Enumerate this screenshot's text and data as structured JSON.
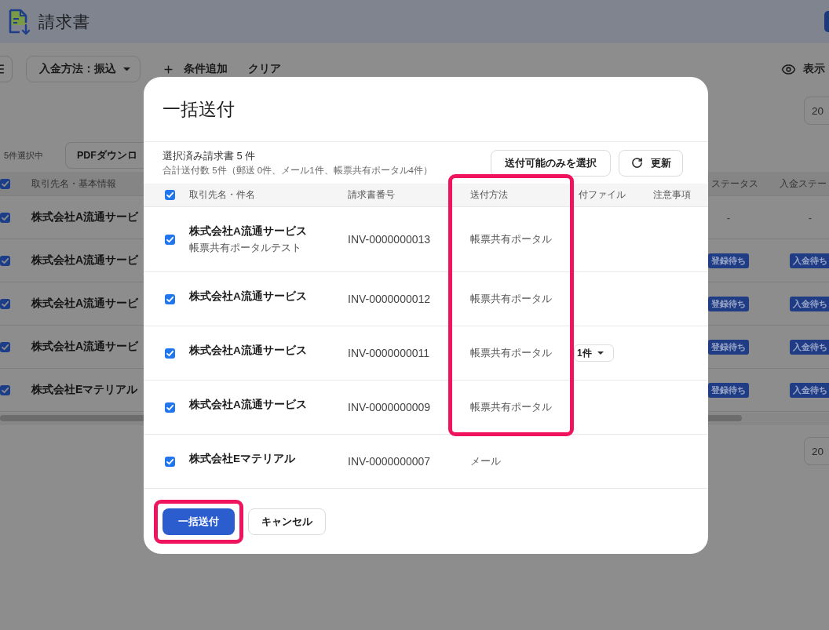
{
  "header": {
    "title": "請求書"
  },
  "filter_bar": {
    "filters": [
      {
        "label": "入金方法：振込"
      }
    ],
    "add_condition": "条件追加",
    "clear": "クリア",
    "display_settings": "表示"
  },
  "top_page_size": "20",
  "selection": {
    "count": "5件選択中",
    "pdf_download": "PDFダウンロ"
  },
  "table": {
    "all_checked": true,
    "columns": [
      "取引先名・基本情報",
      "ステータス",
      "入金ステー"
    ],
    "rows": [
      {
        "checked": true,
        "name": "株式会社A流通サービ",
        "status": {
          "kind": "dash",
          "text": "-"
        },
        "payment_status": {
          "kind": "dash",
          "text": "-"
        }
      },
      {
        "checked": true,
        "name": "株式会社A流通サービ",
        "status": {
          "kind": "badge",
          "text": "登録待ち"
        },
        "payment_status": {
          "kind": "badge",
          "text": "入金待ち"
        }
      },
      {
        "checked": true,
        "name": "株式会社A流通サービ",
        "status": {
          "kind": "badge",
          "text": "登録待ち"
        },
        "payment_status": {
          "kind": "badge",
          "text": "入金待ち"
        }
      },
      {
        "checked": true,
        "name": "株式会社A流通サービ",
        "status": {
          "kind": "badge",
          "text": "登録待ち"
        },
        "payment_status": {
          "kind": "badge",
          "text": "入金待ち"
        }
      },
      {
        "checked": true,
        "name": "株式会社Eマテリアル",
        "status": {
          "kind": "badge",
          "text": "登録待ち"
        },
        "payment_status": {
          "kind": "badge",
          "text": "入金待ち"
        }
      }
    ]
  },
  "bottom_page_size": "20",
  "dialog": {
    "title": "一括送付",
    "summary": "選択済み請求書 5 件",
    "summary_detail": "合計送付数 5件（郵送 0件、メール1件、帳票共有ポータル4件）",
    "select_sendable_button": "送付可能のみを選択",
    "refresh_button": "更新",
    "table": {
      "all_checked": true,
      "columns": [
        {
          "label": "取引先名・件名"
        },
        {
          "label": "請求書番号"
        },
        {
          "label": "送付方法",
          "highlighted": true
        },
        {
          "label": "付ファイル"
        },
        {
          "label": "注意事項"
        }
      ],
      "rows": [
        {
          "checked": true,
          "name": "株式会社A流通サービス",
          "subject": "帳票共有ポータルテスト",
          "invoice_number": "INV-0000000013",
          "method": "帳票共有ポータル",
          "highlighted": true
        },
        {
          "checked": true,
          "name": "株式会社A流通サービス",
          "invoice_number": "INV-0000000012",
          "method": "帳票共有ポータル",
          "highlighted": true
        },
        {
          "checked": true,
          "name": "株式会社A流通サービス",
          "invoice_number": "INV-0000000011",
          "method": "帳票共有ポータル",
          "attachment": "1件",
          "highlighted": true
        },
        {
          "checked": true,
          "name": "株式会社A流通サービス",
          "invoice_number": "INV-0000000009",
          "method": "帳票共有ポータル",
          "highlighted": true
        },
        {
          "checked": true,
          "name": "株式会社Eマテリアル",
          "invoice_number": "INV-0000000007",
          "method": "メール",
          "highlighted": false
        }
      ]
    },
    "submit_button": {
      "label": "一括送付",
      "highlighted": true
    },
    "cancel_button": "キャンセル"
  }
}
